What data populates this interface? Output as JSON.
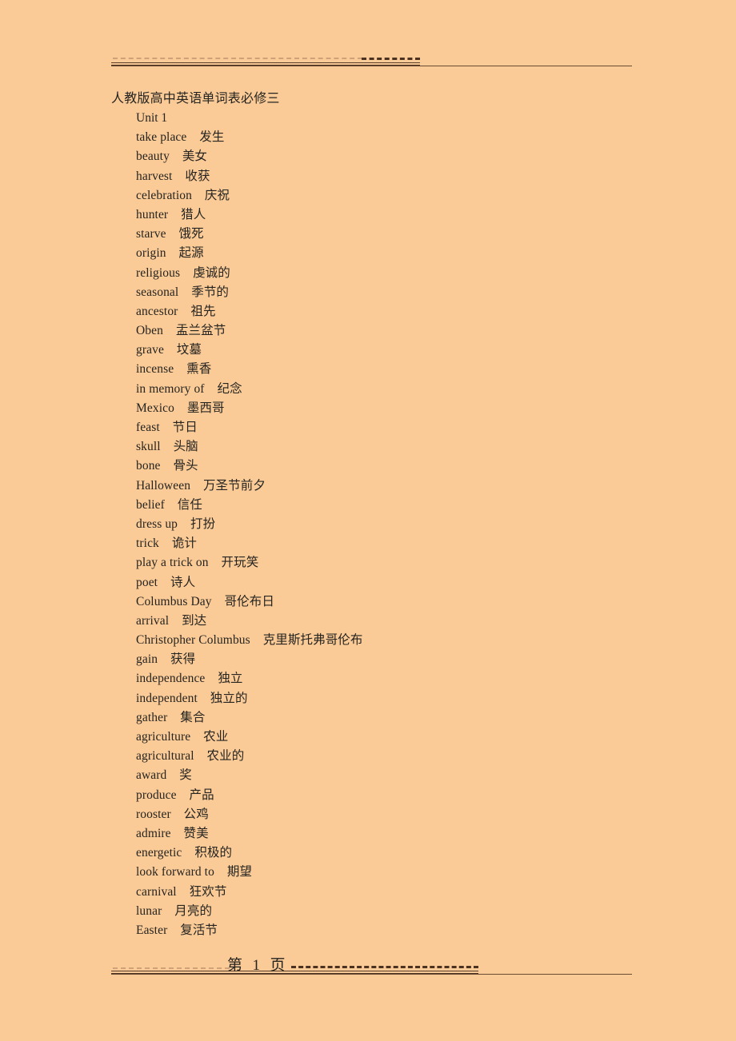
{
  "document": {
    "background_color": "#fbcb97",
    "text_color": "#262420",
    "rule_color": "#4a3120",
    "title": "人教版高中英语单词表必修三",
    "unit_heading": "Unit 1",
    "entries": [
      {
        "term": "take place",
        "gap": "    ",
        "gloss": "发生"
      },
      {
        "term": "beauty",
        "gap": "    ",
        "gloss": "美女"
      },
      {
        "term": "harvest",
        "gap": "    ",
        "gloss": "收获"
      },
      {
        "term": "celebration",
        "gap": "    ",
        "gloss": "庆祝"
      },
      {
        "term": "hunter",
        "gap": "    ",
        "gloss": "猎人"
      },
      {
        "term": "starve",
        "gap": "    ",
        "gloss": "饿死"
      },
      {
        "term": "origin",
        "gap": "    ",
        "gloss": "起源"
      },
      {
        "term": "religious",
        "gap": "    ",
        "gloss": "虔诚的"
      },
      {
        "term": "seasonal",
        "gap": "    ",
        "gloss": "季节的"
      },
      {
        "term": "ancestor",
        "gap": "    ",
        "gloss": "祖先"
      },
      {
        "term": "Oben",
        "gap": "    ",
        "gloss": "盂兰盆节"
      },
      {
        "term": "grave",
        "gap": "    ",
        "gloss": "坟墓"
      },
      {
        "term": "incense",
        "gap": "    ",
        "gloss": "熏香"
      },
      {
        "term": "in memory of",
        "gap": "    ",
        "gloss": "纪念"
      },
      {
        "term": "Mexico",
        "gap": "    ",
        "gloss": "墨西哥"
      },
      {
        "term": "feast",
        "gap": "    ",
        "gloss": "节日"
      },
      {
        "term": "skull",
        "gap": "    ",
        "gloss": "头脑"
      },
      {
        "term": "bone",
        "gap": "    ",
        "gloss": "骨头"
      },
      {
        "term": "Halloween",
        "gap": "    ",
        "gloss": "万圣节前夕"
      },
      {
        "term": "belief",
        "gap": "    ",
        "gloss": "信任"
      },
      {
        "term": "dress up",
        "gap": "    ",
        "gloss": "打扮"
      },
      {
        "term": "trick",
        "gap": "    ",
        "gloss": "诡计"
      },
      {
        "term": "play a trick on",
        "gap": "    ",
        "gloss": "开玩笑"
      },
      {
        "term": "poet",
        "gap": "    ",
        "gloss": "诗人"
      },
      {
        "term": "Columbus Day",
        "gap": "    ",
        "gloss": "哥伦布日"
      },
      {
        "term": "arrival",
        "gap": "    ",
        "gloss": "到达"
      },
      {
        "term": "Christopher Columbus",
        "gap": "    ",
        "gloss": "克里斯托弗哥伦布"
      },
      {
        "term": "gain",
        "gap": "    ",
        "gloss": "获得"
      },
      {
        "term": "independence",
        "gap": "    ",
        "gloss": "独立"
      },
      {
        "term": "independent",
        "gap": "    ",
        "gloss": "独立的"
      },
      {
        "term": "gather",
        "gap": "    ",
        "gloss": "集合"
      },
      {
        "term": "agriculture",
        "gap": "    ",
        "gloss": "农业"
      },
      {
        "term": "agricultural",
        "gap": "    ",
        "gloss": "农业的"
      },
      {
        "term": "award",
        "gap": "    ",
        "gloss": "奖"
      },
      {
        "term": "produce",
        "gap": "    ",
        "gloss": "产品"
      },
      {
        "term": "rooster",
        "gap": "    ",
        "gloss": "公鸡"
      },
      {
        "term": "admire",
        "gap": "    ",
        "gloss": "赞美"
      },
      {
        "term": "energetic",
        "gap": "    ",
        "gloss": "积极的"
      },
      {
        "term": "look forward to",
        "gap": "    ",
        "gloss": "期望"
      },
      {
        "term": "carnival",
        "gap": "    ",
        "gloss": "狂欢节"
      },
      {
        "term": "lunar",
        "gap": "    ",
        "gloss": "月亮的"
      },
      {
        "term": "Easter",
        "gap": "    ",
        "gloss": "复活节"
      }
    ]
  },
  "footer": {
    "page_label": "第  1  页"
  }
}
